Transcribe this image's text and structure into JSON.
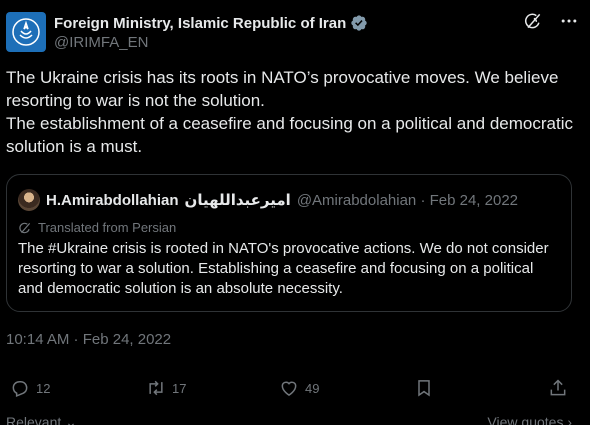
{
  "author": {
    "name": "Foreign Ministry, Islamic Republic of Iran",
    "handle": "@IRIMFA_EN"
  },
  "tweet": {
    "line1": "The Ukraine crisis has its roots in NATO’s provocative moves. We believe resorting to war is not the solution.",
    "line2": "The establishment of a ceasefire and focusing on a political and democratic solution is a must."
  },
  "quote": {
    "name": "H.Amirabdollahian",
    "name_arabic": "امیرعبداللهیان",
    "handle_date": "@Amirabdolahian · Feb 24, 2022",
    "translated_label": "Translated from Persian",
    "text": "The #Ukraine crisis is rooted in NATO's provocative actions. We do not consider resorting to war a solution. Establishing a ceasefire and focusing on a political and democratic solution is an absolute necessity."
  },
  "timestamp": "10:14 AM · Feb 24, 2022",
  "actions": {
    "replies": "12",
    "reposts": "17",
    "likes": "49"
  },
  "footer": {
    "relevant": "Relevant ⌄",
    "view_quotes": "View quotes ›"
  },
  "colors": {
    "background": "#000000",
    "text": "#e7e9ea",
    "muted": "#71767b",
    "border": "#2f3336",
    "verified_badge": "#829aab"
  },
  "icons": [
    "gov-seal-icon",
    "verified-badge-icon",
    "grok-icon",
    "more-icon",
    "translate-icon",
    "reply-icon",
    "repost-icon",
    "like-icon",
    "bookmark-icon",
    "share-icon"
  ]
}
